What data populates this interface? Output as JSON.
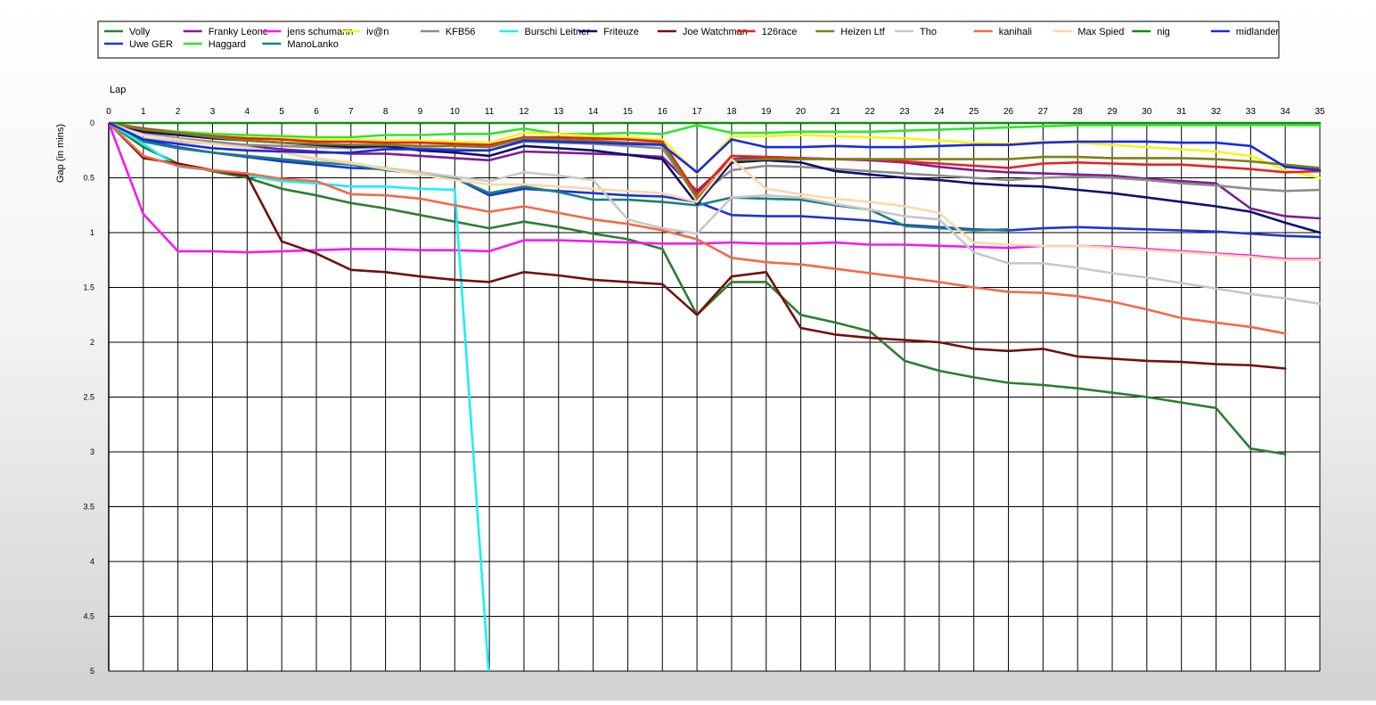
{
  "chart_data": {
    "type": "line",
    "title": "",
    "xlabel": "Lap",
    "ylabel": "Gap (in mins)",
    "xlim": [
      0,
      35
    ],
    "ylim": [
      0,
      5
    ],
    "y_inverted": true,
    "x_ticks": [
      0,
      1,
      2,
      3,
      4,
      5,
      6,
      7,
      8,
      9,
      10,
      11,
      12,
      13,
      14,
      15,
      16,
      17,
      18,
      19,
      20,
      21,
      22,
      23,
      24,
      25,
      26,
      27,
      28,
      29,
      30,
      31,
      32,
      33,
      34,
      35
    ],
    "y_ticks": [
      0,
      0.5,
      1,
      1.5,
      2,
      2.5,
      3,
      3.5,
      4,
      4.5,
      5
    ],
    "grid": true,
    "legend_position": "top",
    "series": [
      {
        "name": "Volly",
        "color": "#2E7D32",
        "values": [
          0,
          0.22,
          0.37,
          0.44,
          0.5,
          0.6,
          0.66,
          0.73,
          0.78,
          0.84,
          0.9,
          0.96,
          0.9,
          0.95,
          1.01,
          1.06,
          1.15,
          1.75,
          1.45,
          1.45,
          1.75,
          1.82,
          1.9,
          2.17,
          2.26,
          2.32,
          2.37,
          2.39,
          2.42,
          2.46,
          2.5,
          2.55,
          2.6,
          2.97,
          3.02,
          null
        ]
      },
      {
        "name": "Uwe GER",
        "color": "#1A35D6",
        "values": [
          0,
          0.16,
          0.22,
          0.27,
          0.31,
          0.35,
          0.38,
          0.41,
          0.42,
          0.45,
          0.5,
          0.66,
          0.6,
          0.62,
          0.64,
          0.66,
          0.67,
          0.72,
          0.84,
          0.85,
          0.85,
          0.87,
          0.89,
          0.93,
          0.95,
          0.97,
          0.98,
          0.96,
          0.95,
          0.96,
          0.97,
          0.98,
          0.99,
          1.01,
          1.03,
          1.04
        ]
      },
      {
        "name": "Franky Leone",
        "color": "#7E1F8E",
        "values": [
          0,
          0.1,
          0.14,
          0.19,
          0.21,
          0.24,
          0.26,
          0.28,
          0.28,
          0.3,
          0.32,
          0.34,
          0.26,
          0.27,
          0.28,
          0.29,
          0.31,
          0.62,
          0.33,
          0.31,
          0.32,
          0.33,
          0.34,
          0.36,
          0.4,
          0.43,
          0.45,
          0.46,
          0.47,
          0.48,
          0.51,
          0.53,
          0.55,
          0.78,
          0.85,
          0.87
        ]
      },
      {
        "name": "Haggard",
        "color": "#2EE62E",
        "values": [
          0,
          0.05,
          0.08,
          0.1,
          0.11,
          0.12,
          0.13,
          0.13,
          0.11,
          0.11,
          0.1,
          0.1,
          0.05,
          0.1,
          0.1,
          0.09,
          0.1,
          0.02,
          0.09,
          0.09,
          0.08,
          0.08,
          0.08,
          0.07,
          0.06,
          0.05,
          0.04,
          0.03,
          0.02,
          0.02,
          0.02,
          0.02,
          0.02,
          0.02,
          0.02,
          0.02
        ]
      },
      {
        "name": "jens_schumann",
        "color": "#F21BF2",
        "values": [
          0,
          0.83,
          1.17,
          1.17,
          1.18,
          1.17,
          1.16,
          1.15,
          1.15,
          1.16,
          1.16,
          1.17,
          1.07,
          1.07,
          1.08,
          1.09,
          1.1,
          1.1,
          1.09,
          1.1,
          1.1,
          1.09,
          1.11,
          1.11,
          1.12,
          1.13,
          1.14,
          1.12,
          1.12,
          1.13,
          1.15,
          1.17,
          1.19,
          1.21,
          1.24,
          1.24
        ]
      },
      {
        "name": "ManoLanko",
        "color": "#1A7F7F",
        "values": [
          0,
          0.17,
          0.23,
          0.27,
          0.3,
          0.33,
          0.36,
          0.38,
          0.43,
          0.46,
          0.5,
          0.64,
          0.58,
          0.63,
          0.7,
          0.7,
          0.72,
          0.75,
          0.68,
          0.69,
          0.7,
          0.75,
          0.79,
          0.94,
          0.96,
          0.98,
          0.97,
          null,
          null,
          null,
          null,
          null,
          null,
          null,
          null,
          null
        ]
      },
      {
        "name": "iv@n",
        "color": "#F5F51A",
        "values": [
          0,
          0.06,
          0.1,
          0.12,
          0.13,
          0.14,
          0.15,
          0.15,
          0.16,
          0.16,
          0.17,
          0.18,
          0.09,
          0.1,
          0.12,
          0.13,
          0.15,
          0.46,
          0.12,
          0.12,
          0.11,
          0.12,
          0.13,
          0.14,
          0.16,
          0.18,
          0.19,
          0.17,
          0.18,
          0.2,
          0.22,
          0.24,
          0.26,
          0.3,
          0.43,
          0.5
        ]
      },
      {
        "name": "KFB56",
        "color": "#8C8C8C",
        "values": [
          0,
          0.09,
          0.14,
          0.17,
          0.2,
          0.21,
          0.22,
          0.23,
          0.22,
          0.23,
          0.24,
          0.25,
          0.17,
          0.18,
          0.19,
          0.21,
          0.23,
          0.68,
          0.43,
          0.39,
          0.4,
          0.42,
          0.44,
          0.46,
          0.48,
          0.5,
          0.52,
          0.5,
          0.49,
          0.5,
          0.52,
          0.55,
          0.57,
          0.6,
          0.62,
          0.61
        ]
      },
      {
        "name": "Burschi Leitner",
        "color": "#1AF0F0",
        "values": [
          0,
          0.19,
          0.4,
          0.43,
          0.48,
          0.53,
          0.55,
          0.58,
          0.58,
          0.6,
          0.61,
          5.1,
          null,
          null,
          null,
          null,
          null,
          null,
          null,
          null,
          null,
          null,
          null,
          null,
          null,
          null,
          null,
          null,
          null,
          null,
          null,
          null,
          null,
          null,
          null,
          null
        ]
      },
      {
        "name": "Friteuze",
        "color": "#0F0F70",
        "values": [
          0,
          0.08,
          0.11,
          0.14,
          0.16,
          0.18,
          0.2,
          0.22,
          0.21,
          0.25,
          0.27,
          0.3,
          0.21,
          0.23,
          0.25,
          0.29,
          0.33,
          0.74,
          0.36,
          0.34,
          0.36,
          0.44,
          0.47,
          0.5,
          0.52,
          0.55,
          0.57,
          0.58,
          0.61,
          0.64,
          0.68,
          0.72,
          0.76,
          0.81,
          0.91,
          1.0
        ]
      },
      {
        "name": "Joe Watchman",
        "color": "#731010",
        "values": [
          0,
          0.32,
          0.37,
          0.43,
          0.48,
          1.08,
          1.19,
          1.34,
          1.36,
          1.4,
          1.43,
          1.45,
          1.36,
          1.39,
          1.43,
          1.45,
          1.47,
          1.75,
          1.4,
          1.36,
          1.87,
          1.93,
          1.96,
          1.98,
          2.0,
          2.06,
          2.08,
          2.06,
          2.13,
          2.15,
          2.17,
          2.18,
          2.2,
          2.21,
          2.24,
          null
        ]
      },
      {
        "name": "126race",
        "color": "#E82020",
        "values": [
          0,
          0.05,
          0.09,
          0.12,
          0.14,
          0.15,
          0.17,
          0.17,
          0.18,
          0.18,
          0.19,
          0.2,
          0.13,
          0.13,
          0.14,
          0.15,
          0.17,
          0.65,
          0.3,
          0.31,
          0.32,
          0.33,
          0.33,
          0.35,
          0.37,
          0.39,
          0.41,
          0.37,
          0.36,
          0.37,
          0.38,
          0.38,
          0.4,
          0.42,
          0.45,
          0.44
        ]
      },
      {
        "name": "Heizen Ltf",
        "color": "#7F7F14",
        "values": [
          0,
          0.06,
          0.09,
          0.13,
          0.16,
          0.18,
          0.19,
          0.2,
          0.2,
          0.21,
          0.21,
          0.22,
          0.14,
          0.15,
          0.16,
          0.18,
          0.19,
          0.69,
          0.34,
          0.33,
          0.33,
          0.33,
          0.33,
          0.33,
          0.33,
          0.33,
          0.33,
          0.31,
          0.31,
          0.32,
          0.32,
          0.32,
          0.33,
          0.35,
          0.38,
          0.41
        ]
      },
      {
        "name": "Tho",
        "color": "#C8C8C8",
        "values": [
          0,
          0.14,
          0.17,
          0.19,
          0.22,
          0.27,
          0.33,
          0.37,
          0.41,
          0.45,
          0.49,
          0.53,
          0.45,
          0.48,
          0.52,
          0.88,
          0.96,
          1.01,
          0.68,
          0.66,
          0.68,
          0.74,
          0.79,
          0.85,
          0.88,
          1.18,
          1.28,
          1.28,
          1.32,
          1.37,
          1.41,
          1.46,
          1.51,
          1.56,
          1.6,
          1.65
        ]
      },
      {
        "name": "kanihali",
        "color": "#F26A4A",
        "values": [
          0,
          0.3,
          0.39,
          0.43,
          0.46,
          0.51,
          0.53,
          0.65,
          0.66,
          0.69,
          0.75,
          0.81,
          0.76,
          0.82,
          0.88,
          0.92,
          0.98,
          1.06,
          1.23,
          1.27,
          1.29,
          1.33,
          1.37,
          1.41,
          1.45,
          1.5,
          1.54,
          1.55,
          1.58,
          1.63,
          1.7,
          1.78,
          1.82,
          1.86,
          1.92,
          null
        ]
      },
      {
        "name": "Max Spied",
        "color": "#FAD8A8",
        "values": [
          0,
          0.11,
          0.15,
          0.19,
          0.23,
          0.27,
          0.32,
          0.36,
          0.42,
          0.47,
          0.52,
          0.56,
          0.56,
          0.58,
          0.6,
          0.62,
          0.64,
          0.72,
          0.33,
          0.6,
          0.65,
          0.69,
          0.72,
          0.76,
          0.82,
          1.09,
          1.11,
          1.12,
          1.12,
          1.14,
          1.16,
          1.18,
          1.2,
          1.22,
          1.25,
          1.25
        ]
      },
      {
        "name": "nig",
        "color": "#138A13",
        "values": [
          0,
          0,
          0,
          0,
          0,
          0,
          0,
          0,
          0,
          0,
          0,
          0,
          0,
          0,
          0,
          0,
          0,
          0,
          0,
          0,
          0,
          0,
          0,
          0,
          0,
          0,
          0,
          0,
          0,
          0,
          0,
          0,
          0,
          0,
          0,
          0
        ]
      },
      {
        "name": "midlander",
        "color": "#1A2AE0",
        "values": [
          0,
          0.15,
          0.19,
          0.23,
          0.25,
          0.26,
          0.27,
          0.27,
          0.24,
          0.24,
          0.25,
          0.25,
          0.16,
          0.17,
          0.18,
          0.19,
          0.2,
          0.45,
          0.15,
          0.22,
          0.22,
          0.21,
          0.22,
          0.22,
          0.21,
          0.2,
          0.2,
          0.18,
          0.17,
          0.17,
          0.17,
          0.18,
          0.18,
          0.21,
          0.4,
          0.43
        ]
      }
    ]
  }
}
